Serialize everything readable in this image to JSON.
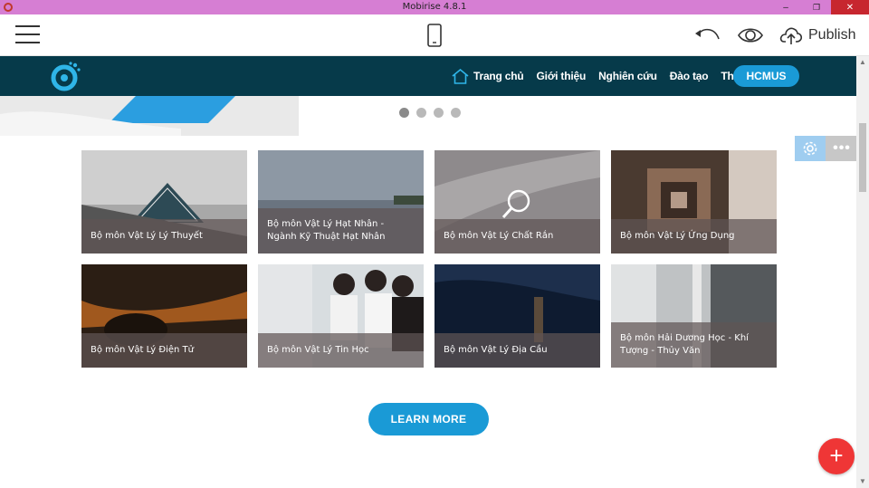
{
  "window": {
    "title": "Mobirise 4.8.1",
    "minimize": "–",
    "restore": "❐",
    "close": "✕"
  },
  "toolbar": {
    "publish_label": "Publish"
  },
  "nav": {
    "items": [
      "Trang chủ",
      "Giới thiệu",
      "Nghiên cứu",
      "Đào tạo",
      "Thông báo"
    ],
    "button": "HCMUS"
  },
  "slider": {
    "dots": 4,
    "active_dot": 1
  },
  "block_settings": {
    "more_label": "•••"
  },
  "cards": [
    {
      "label": "Bộ môn Vật Lý Lý Thuyết"
    },
    {
      "label": "Bộ môn Vật Lý Hạt Nhân - Ngành Kỹ Thuật Hạt Nhân"
    },
    {
      "label": "Bộ môn Vật Lý Chất Rắn"
    },
    {
      "label": "Bộ môn Vật Lý Ứng Dụng"
    },
    {
      "label": "Bộ môn Vật Lý Điện Tử"
    },
    {
      "label": "Bộ môn Vật Lý Tin Học"
    },
    {
      "label": "Bộ môn Vật Lý Địa Cầu"
    },
    {
      "label": "Bộ môn Hải Dương Học - Khí Tượng - Thủy Văn"
    }
  ],
  "learn_more": "LEARN MORE",
  "fab_label": "+",
  "colors": {
    "navbar": "#063a4a",
    "accent": "#1a9ad6",
    "fab": "#ef3636",
    "titlebar": "#d67ed3"
  }
}
